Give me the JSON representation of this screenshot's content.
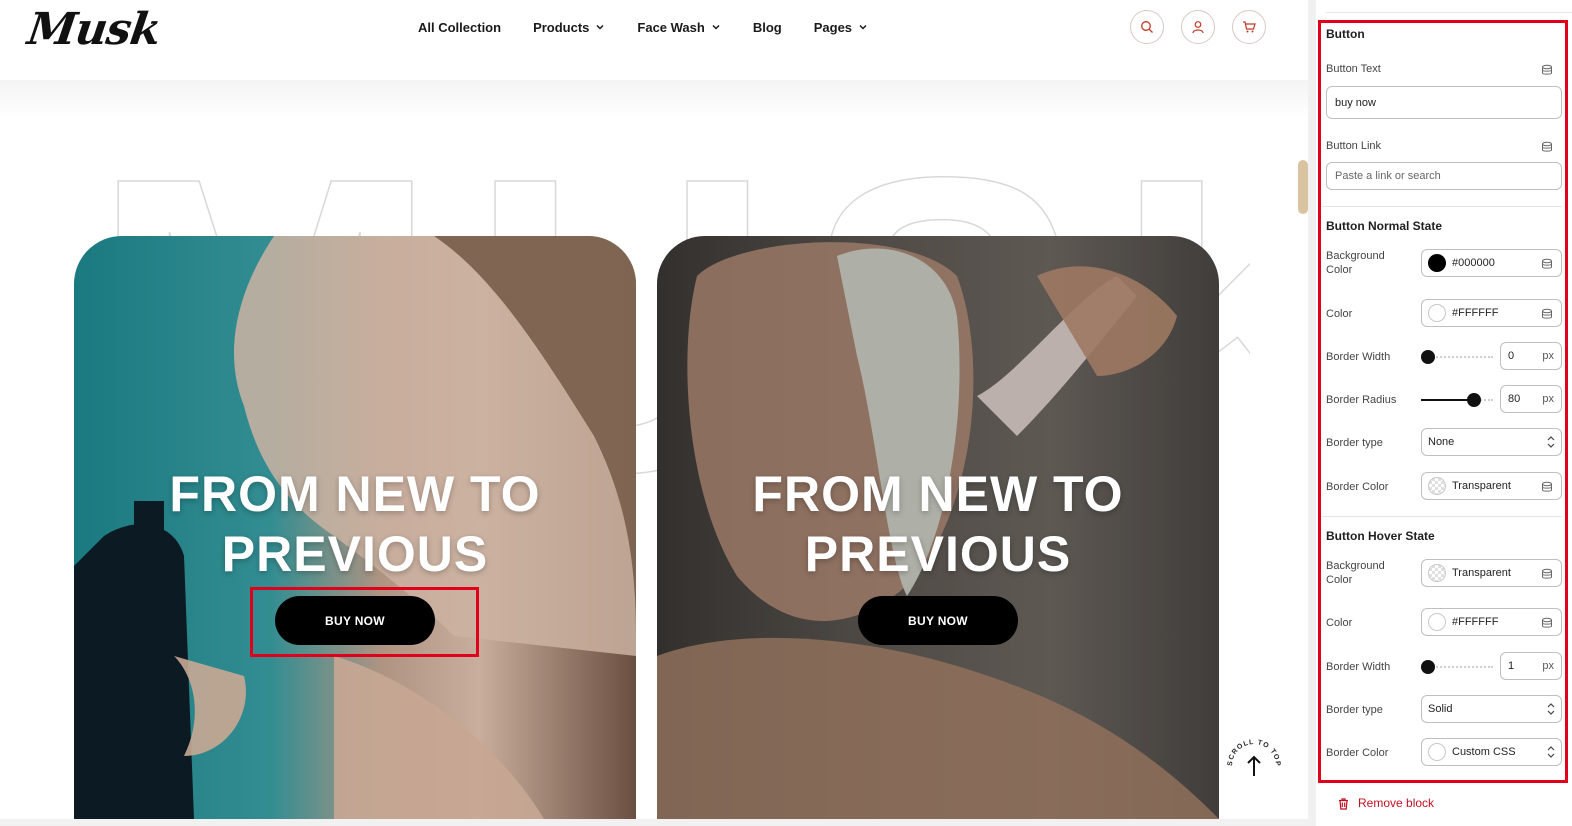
{
  "header": {
    "logo": "Musk",
    "nav": [
      {
        "label": "All Collection",
        "dropdown": false
      },
      {
        "label": "Products",
        "dropdown": true
      },
      {
        "label": "Face Wash",
        "dropdown": true
      },
      {
        "label": "Blog",
        "dropdown": false
      },
      {
        "label": "Pages",
        "dropdown": true
      }
    ],
    "icons": [
      "search-icon",
      "user-icon",
      "cart-icon"
    ]
  },
  "hero": {
    "watermark_text": "MUSK",
    "cards": [
      {
        "title_line1": "FROM NEW TO",
        "title_line2": "PREVIOUS",
        "button": "BUY NOW"
      },
      {
        "title_line1": "FROM NEW TO",
        "title_line2": "PREVIOUS",
        "button": "BUY NOW"
      }
    ],
    "scroll_to_top": "SCROLL TO TOP"
  },
  "panel": {
    "section_button": "Button",
    "button_text_label": "Button Text",
    "button_text_value": "buy now",
    "button_link_label": "Button Link",
    "button_link_placeholder": "Paste a link or search",
    "normal_state": {
      "title": "Button Normal State",
      "bg_label_1": "Background",
      "bg_label_2": "Color",
      "bg_value": "#000000",
      "color_label": "Color",
      "color_value": "#FFFFFF",
      "border_width_label": "Border Width",
      "border_width_value": "0",
      "border_width_unit": "px",
      "border_radius_label": "Border Radius",
      "border_radius_value": "80",
      "border_radius_unit": "px",
      "border_type_label": "Border type",
      "border_type_value": "None",
      "border_color_label": "Border Color",
      "border_color_value": "Transparent"
    },
    "hover_state": {
      "title": "Button Hover State",
      "bg_label_1": "Background",
      "bg_label_2": "Color",
      "bg_value": "Transparent",
      "color_label": "Color",
      "color_value": "#FFFFFF",
      "border_width_label": "Border Width",
      "border_width_value": "1",
      "border_width_unit": "px",
      "border_type_label": "Border type",
      "border_type_value": "Solid",
      "border_color_label": "Border Color",
      "border_color_value": "Custom CSS"
    },
    "remove_block": "Remove block"
  },
  "colors": {
    "accent_red": "#e0001b",
    "remove_red": "#c40f22",
    "button_bg": "#000000",
    "button_text": "#FFFFFF"
  }
}
